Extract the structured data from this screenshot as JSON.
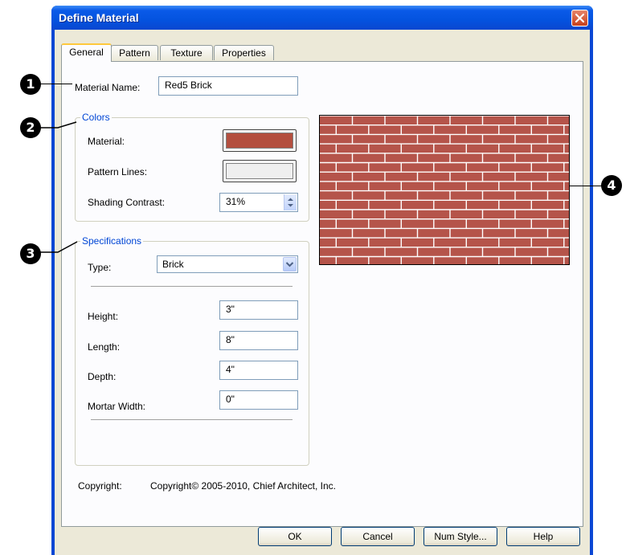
{
  "window": {
    "title": "Define Material"
  },
  "tabs": [
    "General",
    "Pattern",
    "Texture",
    "Properties"
  ],
  "general": {
    "material_name_label": "Material Name:",
    "material_name_value": "Red5 Brick"
  },
  "colors": {
    "legend": "Colors",
    "material_label": "Material:",
    "material_color": "#b34f3f",
    "pattern_lines_label": "Pattern Lines:",
    "pattern_lines_color": "#efefef",
    "shading_label": "Shading Contrast:",
    "shading_value": "31%"
  },
  "specifications": {
    "legend": "Specifications",
    "type_label": "Type:",
    "type_value": "Brick",
    "height_label": "Height:",
    "height_value": "3\"",
    "length_label": "Length:",
    "length_value": "8\"",
    "depth_label": "Depth:",
    "depth_value": "4\"",
    "mortar_label": "Mortar Width:",
    "mortar_value": "0\""
  },
  "copyright": {
    "label": "Copyright:",
    "value": "Copyright© 2005-2010, Chief Architect, Inc."
  },
  "buttons": {
    "ok": "OK",
    "cancel": "Cancel",
    "num_style": "Num Style...",
    "help": "Help"
  },
  "callouts": [
    "1",
    "2",
    "3",
    "4"
  ],
  "preview": {
    "brick_color": "#b5544a",
    "mortar_color": "#ffffff"
  }
}
